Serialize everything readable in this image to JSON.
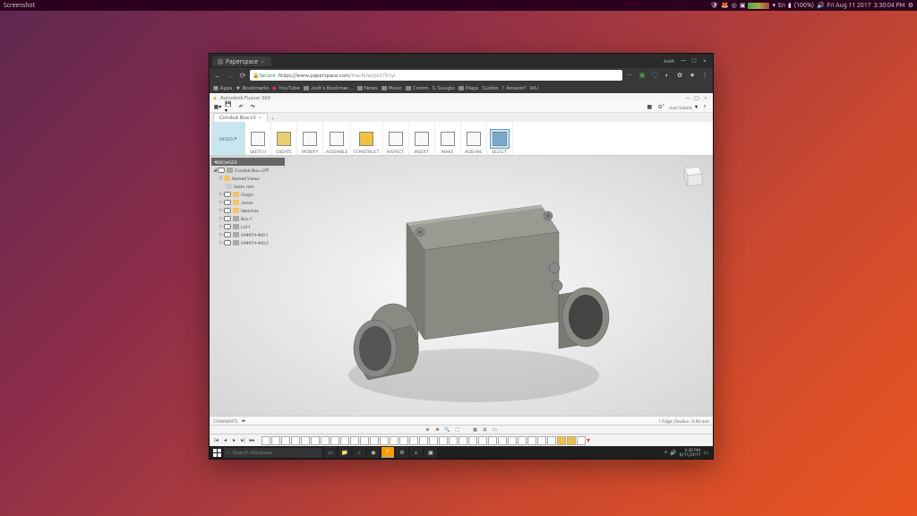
{
  "ubuntu": {
    "title": "Screenshot",
    "battery": "(100%)",
    "date": "Fri Aug 11 2017",
    "time": "3:30:04 PM",
    "lang": "En"
  },
  "chrome": {
    "tab_title": "Paperspace",
    "user": "Josh",
    "url_secure": "Secure",
    "url_domain": "https://www.paperspace.com",
    "url_path": "/machine/ps5761yi",
    "bookmarks": [
      "Apps",
      "Bookmarks",
      "YouTube",
      "Josh's Bookmar…",
      "News",
      "Music",
      "Comm",
      "Google",
      "Maps",
      "Guides",
      "Answer?",
      "WU"
    ]
  },
  "fusion": {
    "app_title": "Autodesk Fusion 360",
    "user": "Joan Sobels",
    "tab": "Conduit Box v3",
    "workspace": "MODEL",
    "ribbon": [
      "SKETCH",
      "CREATE",
      "MODIFY",
      "ASSEMBLE",
      "CONSTRUCT",
      "INSPECT",
      "INSERT",
      "MAKE",
      "ADD-INS",
      "SELECT"
    ],
    "browser_title": "BROWSER",
    "tree_root": "Conduit Box v3",
    "tree": [
      "Named Views",
      "Units: mm",
      "Origin",
      "Joints",
      "Sketches",
      "Box:1",
      "Lid:1",
      "049974-400:1",
      "049974-400:2"
    ],
    "comments": "COMMENTS",
    "status_right": "1 Edge | Radius : 0.00 mm"
  },
  "windows": {
    "search_placeholder": "Search Windows",
    "time": "3:30 PM",
    "date": "8/11/2017"
  }
}
